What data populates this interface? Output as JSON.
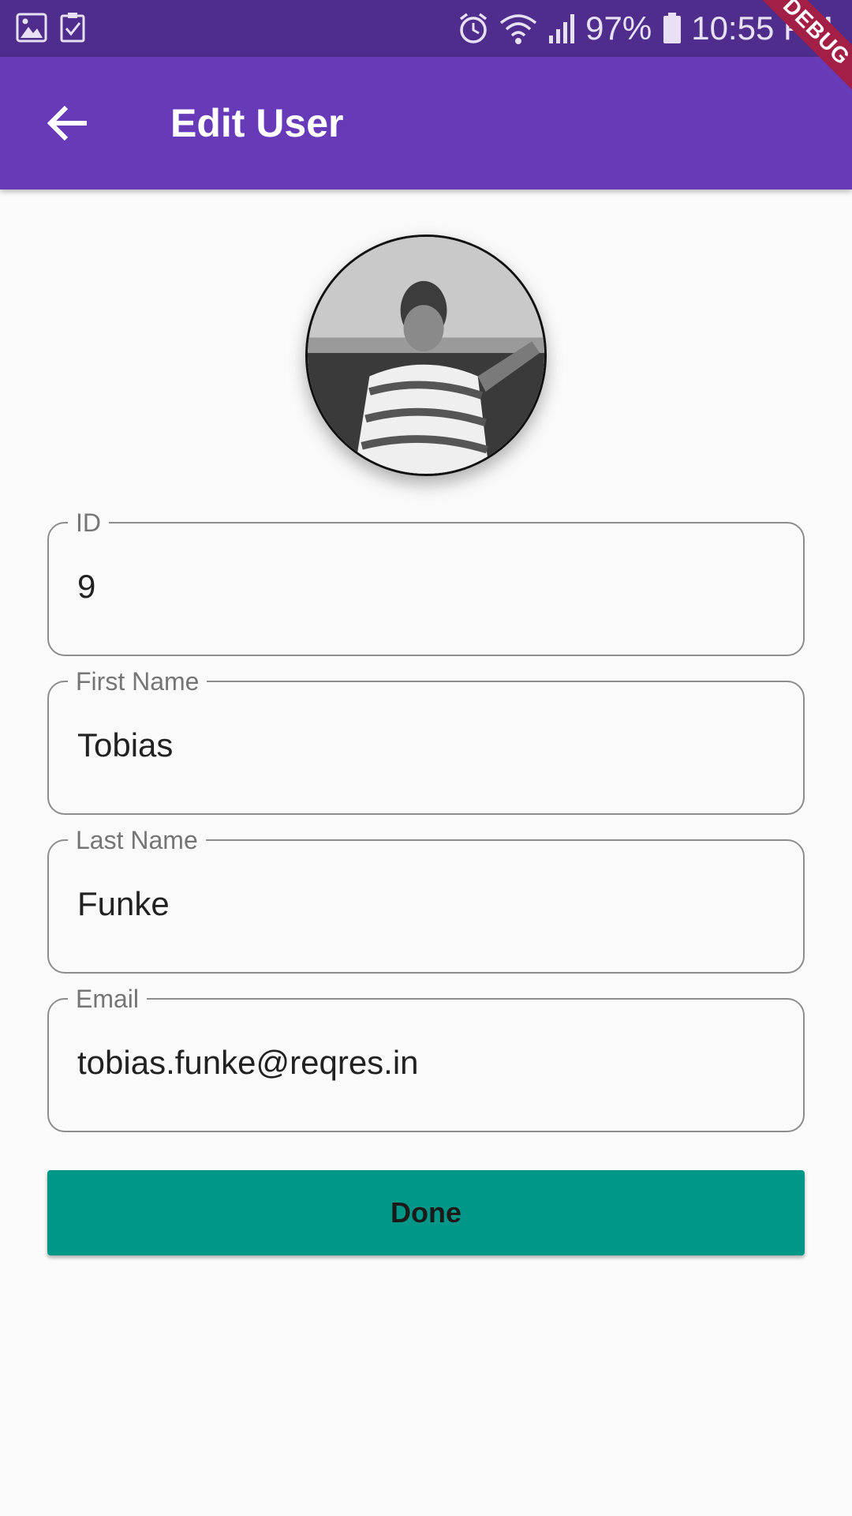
{
  "status_bar": {
    "battery": "97%",
    "time": "10:55 PM",
    "icons": [
      "gallery-icon",
      "task-check-icon",
      "alarm-icon",
      "wifi-icon",
      "signal-icon",
      "battery-icon"
    ]
  },
  "app_bar": {
    "title": "Edit User",
    "back_icon": "arrow-back-icon"
  },
  "debug_banner": "DEBUG",
  "avatar": {
    "icon": "user-photo"
  },
  "form": {
    "fields": [
      {
        "label": "ID",
        "value": "9"
      },
      {
        "label": "First Name",
        "value": "Tobias"
      },
      {
        "label": "Last Name",
        "value": "Funke"
      },
      {
        "label": "Email",
        "value": "tobias.funke@reqres.in"
      }
    ]
  },
  "done_button": {
    "label": "Done"
  },
  "colors": {
    "status_bar": "#4e2d8c",
    "app_bar": "#673ab7",
    "button": "#009688",
    "background": "#fafafa",
    "debug_banner": "#a31f45"
  }
}
